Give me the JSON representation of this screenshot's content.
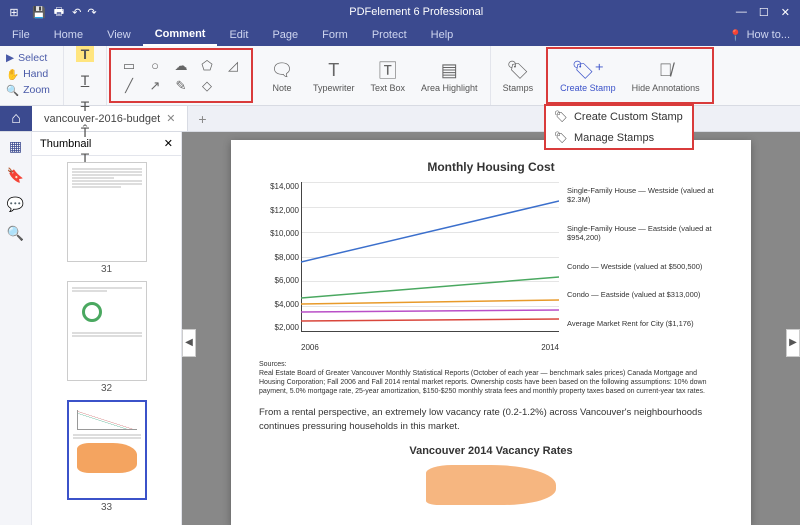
{
  "app": {
    "title": "PDFelement 6 Professional"
  },
  "menu": {
    "items": [
      "File",
      "Home",
      "View",
      "Comment",
      "Edit",
      "Page",
      "Form",
      "Protect",
      "Help"
    ],
    "active": "Comment",
    "howto": "How to..."
  },
  "ribbon": {
    "select_tools": [
      "Select",
      "Hand",
      "Zoom"
    ],
    "tool_buttons": [
      {
        "label": "Note"
      },
      {
        "label": "Typewriter"
      },
      {
        "label": "Text Box"
      },
      {
        "label": "Area Highlight"
      },
      {
        "label": "Stamps"
      },
      {
        "label": "Create Stamp",
        "active": true
      },
      {
        "label": "Hide Annotations"
      }
    ],
    "dropdown": [
      "Create Custom Stamp",
      "Manage Stamps"
    ]
  },
  "tabs": {
    "name": "vancouver-2016-budget"
  },
  "thumbnail": {
    "title": "Thumbnail",
    "pages": [
      "31",
      "32",
      "33"
    ],
    "selected": "33"
  },
  "document": {
    "chart_title": "Monthly Housing Cost",
    "sources_heading": "Sources:",
    "sources_text": "Real Estate Board of Greater Vancouver Monthly Statistical Reports (October of each year — benchmark sales prices) Canada Mortgage and Housing Corporation; Fall 2006 and Fall 2014 rental market reports. Ownership costs have been based on the following assumptions: 10% down payment, 5.0% mortgage rate, 25-year amortization, $150-$250 monthly strata fees and monthly property taxes based on current-year tax rates.",
    "body_text": "From a rental perspective, an extremely low vacancy rate (0.2-1.2%) across Vancouver's neighbourhoods continues pressuring households in this market.",
    "subchart": "Vancouver 2014 Vacancy Rates"
  },
  "chart_data": {
    "type": "line",
    "title": "Monthly Housing Cost",
    "xlabel": "",
    "ylabel": "",
    "x_range": [
      2006,
      2014
    ],
    "y_ticks": [
      "$2,000",
      "$4,000",
      "$6,000",
      "$8,000",
      "$10,000",
      "$12,000",
      "$14,000"
    ],
    "x_ticks": [
      "2006",
      "2014"
    ],
    "ylim": [
      0,
      14000
    ],
    "series": [
      {
        "name": "Single-Family House — Westside (valued at $2.3M)",
        "color": "#3b6fcc",
        "values_2006": 6500,
        "values_2014": 12200
      },
      {
        "name": "Single-Family House — Eastside (valued at $954,200)",
        "color": "#4aa860",
        "values_2006": 3200,
        "values_2014": 5200
      },
      {
        "name": "Condo — Westside (valued at $500,500)",
        "color": "#e89a2a",
        "values_2006": 2600,
        "values_2014": 3000
      },
      {
        "name": "Condo — Eastside (valued at $313,000)",
        "color": "#b94fc7",
        "values_2006": 1900,
        "values_2014": 2100
      },
      {
        "name": "Average Market Rent for City ($1,176)",
        "color": "#d9463b",
        "values_2006": 1000,
        "values_2014": 1200
      }
    ]
  }
}
